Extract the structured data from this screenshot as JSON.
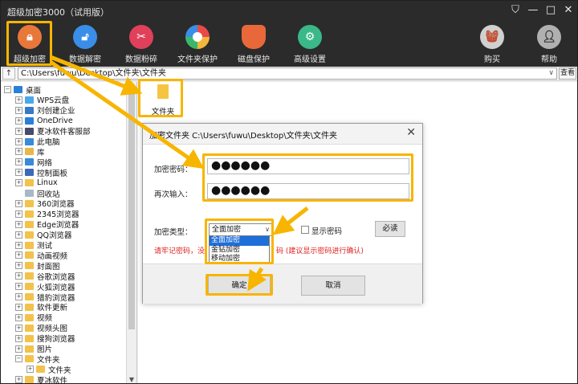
{
  "window": {
    "title": "超级加密3000（试用版）",
    "controls": [
      "shirt",
      "—",
      "□",
      "✕"
    ]
  },
  "toolbar": [
    {
      "label": "超级加密",
      "icon": "lock-icon",
      "color": "#e8783a"
    },
    {
      "label": "数据解密",
      "icon": "unlock-icon",
      "color": "#3a8ee8"
    },
    {
      "label": "数据粉碎",
      "icon": "scissors-icon",
      "color": "#e0405a"
    },
    {
      "label": "文件夹保护",
      "icon": "aperture-icon",
      "color": "#ffffff"
    },
    {
      "label": "磁盘保护",
      "icon": "shield-icon",
      "color": "#e8683a"
    },
    {
      "label": "高级设置",
      "icon": "gear-icon",
      "color": "#3ab888"
    },
    {
      "label": "购买",
      "icon": "basket-icon",
      "color": "#c8c8c8"
    },
    {
      "label": "帮助",
      "icon": "user-icon",
      "color": "#a8a8a8"
    }
  ],
  "address": {
    "up": "↑",
    "path": "C:\\Users\\fuwu\\Desktop\\文件夹\\文件夹",
    "view_button": "查看"
  },
  "tree": [
    {
      "label": "桌面",
      "indent": 0,
      "exp": "−",
      "icon": "#2a7fd8"
    },
    {
      "label": "WPS云盘",
      "indent": 1,
      "exp": "+",
      "icon": "#4aa8e8"
    },
    {
      "label": "刘创建企业",
      "indent": 1,
      "exp": "+",
      "icon": "#3a78c8"
    },
    {
      "label": "OneDrive",
      "indent": 1,
      "exp": "+",
      "icon": "#2a7fd8"
    },
    {
      "label": "夏冰软件客服部",
      "indent": 1,
      "exp": "+",
      "icon": "#4a4a6a"
    },
    {
      "label": "此电脑",
      "indent": 1,
      "exp": "+",
      "icon": "#3a8ad8"
    },
    {
      "label": "库",
      "indent": 1,
      "exp": "+",
      "icon": "#e8b84a"
    },
    {
      "label": "网络",
      "indent": 1,
      "exp": "+",
      "icon": "#3a8ad8"
    },
    {
      "label": "控制面板",
      "indent": 1,
      "exp": "+",
      "icon": "#3a6ab8"
    },
    {
      "label": "Linux",
      "indent": 1,
      "exp": "+",
      "icon": "#f2c24a"
    },
    {
      "label": "回收站",
      "indent": 1,
      "exp": "",
      "icon": "#a8b8c8"
    },
    {
      "label": "360浏览器",
      "indent": 1,
      "exp": "+",
      "icon": "#f2c24a"
    },
    {
      "label": "2345浏览器",
      "indent": 1,
      "exp": "+",
      "icon": "#f2c24a"
    },
    {
      "label": "Edge浏览器",
      "indent": 1,
      "exp": "+",
      "icon": "#f2c24a"
    },
    {
      "label": "QQ浏览器",
      "indent": 1,
      "exp": "+",
      "icon": "#f2c24a"
    },
    {
      "label": "测试",
      "indent": 1,
      "exp": "+",
      "icon": "#f2c24a"
    },
    {
      "label": "动画视频",
      "indent": 1,
      "exp": "+",
      "icon": "#f2c24a"
    },
    {
      "label": "封面图",
      "indent": 1,
      "exp": "+",
      "icon": "#f2c24a"
    },
    {
      "label": "谷歌浏览器",
      "indent": 1,
      "exp": "+",
      "icon": "#f2c24a"
    },
    {
      "label": "火狐浏览器",
      "indent": 1,
      "exp": "+",
      "icon": "#f2c24a"
    },
    {
      "label": "猎豹浏览器",
      "indent": 1,
      "exp": "+",
      "icon": "#f2c24a"
    },
    {
      "label": "软件更新",
      "indent": 1,
      "exp": "+",
      "icon": "#f2c24a"
    },
    {
      "label": "视频",
      "indent": 1,
      "exp": "+",
      "icon": "#f2c24a"
    },
    {
      "label": "视频头图",
      "indent": 1,
      "exp": "+",
      "icon": "#f2c24a"
    },
    {
      "label": "搜狗浏览器",
      "indent": 1,
      "exp": "+",
      "icon": "#f2c24a"
    },
    {
      "label": "图片",
      "indent": 1,
      "exp": "+",
      "icon": "#f2c24a"
    },
    {
      "label": "文件夹",
      "indent": 1,
      "exp": "−",
      "icon": "#f2c24a"
    },
    {
      "label": "文件夹",
      "indent": 2,
      "exp": "+",
      "icon": "#f2c24a"
    },
    {
      "label": "夏冰软件",
      "indent": 1,
      "exp": "+",
      "icon": "#f2c24a"
    }
  ],
  "content": {
    "folder_label": "文件夹"
  },
  "dialog": {
    "title": "加密文件夹 C:\\Users\\fuwu\\Desktop\\文件夹\\文件夹",
    "close": "✕",
    "password_label": "加密密码：",
    "password_value": "●●●●●●",
    "confirm_label": "再次输入：",
    "confirm_value": "●●●●●●",
    "type_label": "加密类型：",
    "type_selected": "全面加密",
    "type_options": [
      "全面加密",
      "金钻加密",
      "移动加密"
    ],
    "show_password_label": "显示密码",
    "must_read_button": "必读",
    "warning_left": "请牢记密码，没",
    "warning_right": "码 (建议显示密码进行确认)",
    "ok_button": "确定",
    "cancel_button": "取消"
  }
}
